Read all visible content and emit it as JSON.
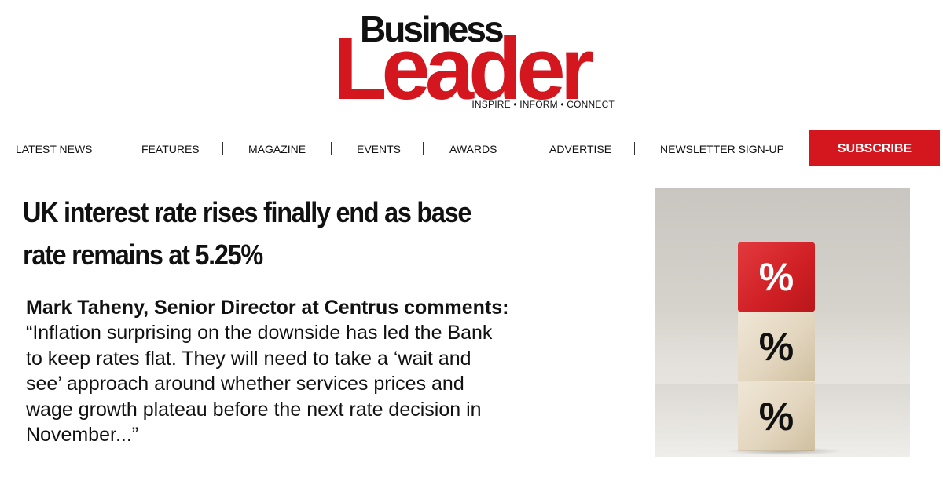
{
  "brand": {
    "top_word": "Business",
    "main_word": "Leader",
    "tagline": "INSPIRE • INFORM • CONNECT",
    "accent_color": "#d4161f"
  },
  "nav": {
    "items": [
      {
        "label": "LATEST NEWS"
      },
      {
        "label": "FEATURES"
      },
      {
        "label": "MAGAZINE"
      },
      {
        "label": "EVENTS"
      },
      {
        "label": "AWARDS"
      },
      {
        "label": "ADVERTISE"
      },
      {
        "label": "NEWSLETTER SIGN-UP"
      }
    ],
    "subscribe_label": "SUBSCRIBE"
  },
  "article": {
    "headline_line1": "UK interest rate rises finally end as base",
    "headline_line2": "rate remains at 5.25%",
    "byline": "Mark Taheny, Senior Director at Centrus comments:",
    "quote_lines": [
      "“Inflation surprising on the downside has led the Bank",
      "to keep rates flat. They will need to take a ‘wait and",
      "see’ approach around whether services prices and",
      "wage growth plateau before the next rate decision in",
      "November...”"
    ]
  },
  "image": {
    "cube_labels": [
      "%",
      "%",
      "%"
    ]
  }
}
